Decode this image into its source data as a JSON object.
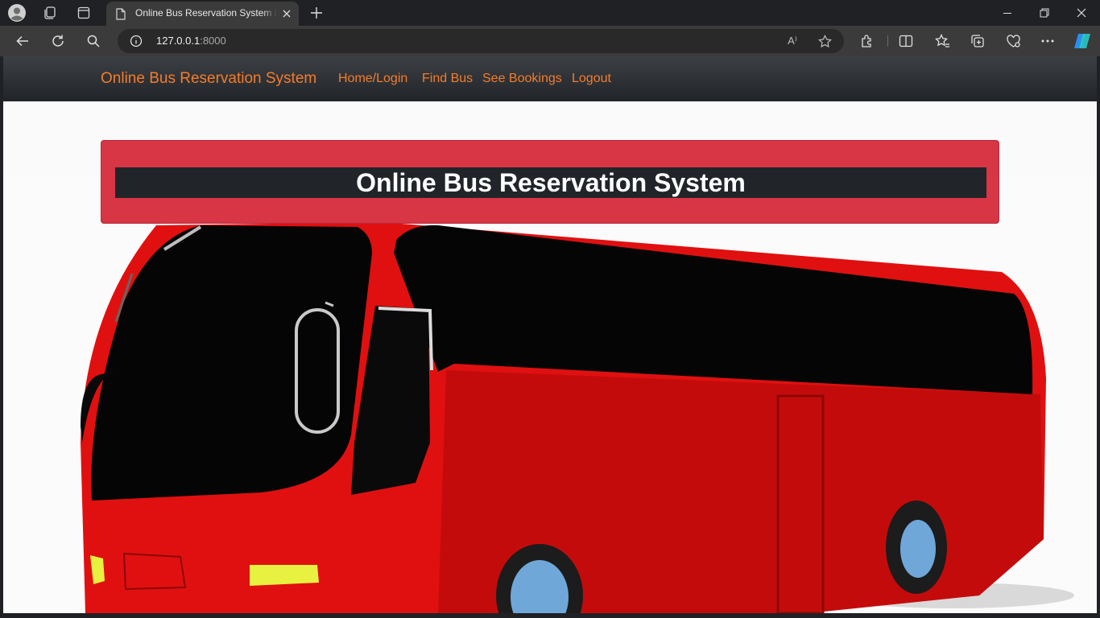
{
  "browser": {
    "tab_title": "Online Bus Reservation System in Django",
    "url_host": "127.0.0.1",
    "url_port": ":8000",
    "read_aloud_label": "A⁾"
  },
  "navbar": {
    "brand": "Online Bus Reservation System",
    "links": [
      "Home/Login",
      "Find Bus",
      "See Bookings",
      "Logout"
    ]
  },
  "hero": {
    "title": "Online Bus Reservation System"
  },
  "colors": {
    "navbar_bg": "#212529",
    "nav_link": "#f57c2a",
    "hero_panel": "#d83545",
    "hero_title_bg": "#212529",
    "bus_body": "#e01010"
  }
}
